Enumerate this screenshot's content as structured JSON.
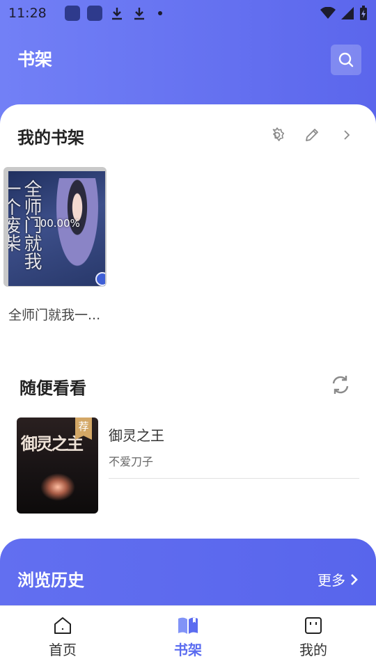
{
  "status_bar": {
    "time": "11:28"
  },
  "header": {
    "title": "书架"
  },
  "shelf": {
    "title": "我的书架",
    "books": [
      {
        "name": "全师门就我一...",
        "progress": "100.00%",
        "cover_text": "全师门就我一个废柴"
      }
    ]
  },
  "random": {
    "title": "随便看看",
    "items": [
      {
        "title": "御灵之王",
        "author": "不爱刀子",
        "tag": "荐",
        "cover_text": "御灵之主"
      }
    ]
  },
  "history": {
    "title": "浏览历史",
    "more": "更多"
  },
  "nav": {
    "items": [
      {
        "label": "首页",
        "icon": "home-icon"
      },
      {
        "label": "书架",
        "icon": "book-icon",
        "active": true
      },
      {
        "label": "我的",
        "icon": "profile-icon"
      }
    ]
  },
  "colors": {
    "accent": "#5b6cf0",
    "header": "#6e7bf5"
  }
}
